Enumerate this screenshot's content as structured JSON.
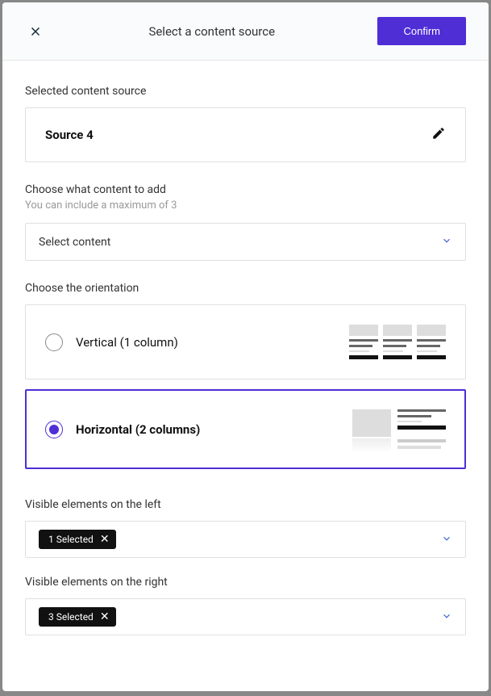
{
  "header": {
    "title": "Select a content source",
    "confirm": "Confirm"
  },
  "selected_source": {
    "label": "Selected content source",
    "name": "Source 4"
  },
  "content_add": {
    "label": "Choose what content to add",
    "hint": "You can include a maximum of 3",
    "placeholder": "Select content"
  },
  "orientation": {
    "label": "Choose the orientation",
    "vertical": "Vertical (1 column)",
    "horizontal": "Horizontal (2 columns)"
  },
  "visible_left": {
    "label": "Visible elements on the left",
    "selected": "1 Selected"
  },
  "visible_right": {
    "label": "Visible elements on the right",
    "selected": "3 Selected"
  }
}
